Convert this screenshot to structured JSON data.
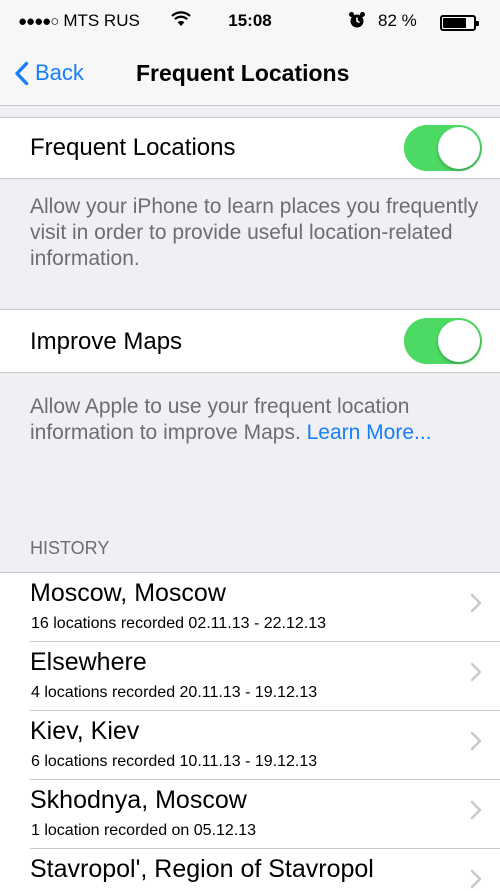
{
  "status_bar": {
    "signal": "●●●●○",
    "carrier": "MTS RUS",
    "time": "15:08",
    "battery_percent": "82 %",
    "battery_level": 0.82,
    "icons": [
      "wifi-icon",
      "alarm-icon",
      "battery-icon"
    ]
  },
  "nav": {
    "back_label": "Back",
    "title": "Frequent Locations"
  },
  "frequent_locations": {
    "label": "Frequent Locations",
    "enabled": true,
    "description": "Allow your iPhone to learn places you frequently visit in order to provide useful location-related information."
  },
  "improve_maps": {
    "label": "Improve Maps",
    "enabled": true,
    "description": "Allow Apple to use your frequent location information to improve Maps.",
    "link": "Learn More..."
  },
  "history": {
    "header": "HISTORY",
    "items": [
      {
        "name": "Moscow, Moscow",
        "detail": "16 locations recorded 02.11.13 - 22.12.13"
      },
      {
        "name": "Elsewhere",
        "detail": "4 locations recorded 20.11.13 - 19.12.13"
      },
      {
        "name": "Kiev, Kiev",
        "detail": "6 locations recorded 10.11.13 - 19.12.13"
      },
      {
        "name": "Skhodnya, Moscow",
        "detail": "1 location recorded on 05.12.13"
      },
      {
        "name": "Stavropol', Region of Stavropol",
        "detail": ""
      }
    ]
  },
  "colors": {
    "accent": "#157efb",
    "toggle_on": "#4cd964",
    "group_background": "#efeff4",
    "secondary_text": "#6d6d72"
  }
}
